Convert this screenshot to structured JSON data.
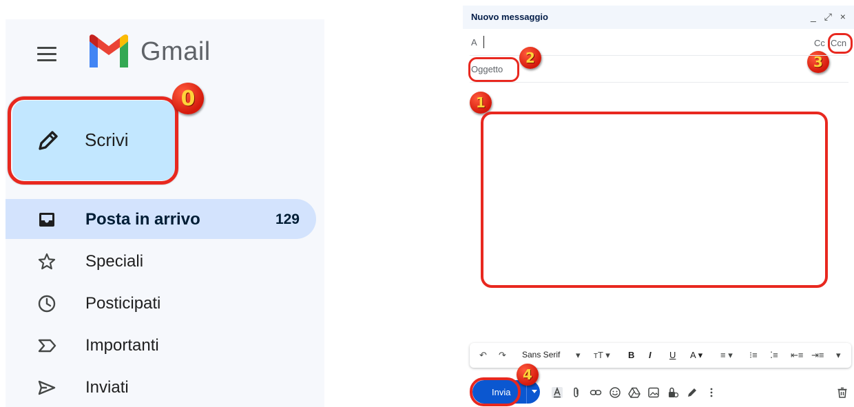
{
  "sidebar": {
    "brand": "Gmail",
    "compose_label": "Scrivi",
    "items": [
      {
        "label": "Posta in arrivo",
        "count": "129",
        "icon": "inbox-icon",
        "active": true
      },
      {
        "label": "Speciali",
        "icon": "star-icon"
      },
      {
        "label": "Posticipati",
        "icon": "clock-icon"
      },
      {
        "label": "Importanti",
        "icon": "important-icon"
      },
      {
        "label": "Inviati",
        "icon": "send-icon"
      }
    ]
  },
  "compose": {
    "title": "Nuovo messaggio",
    "window_controls": "_ ⤢ ×",
    "to_label": "A",
    "cc_label": "Cc",
    "bcc_label": "Ccn",
    "subject_placeholder": "Oggetto",
    "send_label": "Invia",
    "font_name": "Sans Serif",
    "format_buttons": [
      "↶",
      "↷",
      "Sans Serif",
      "▾",
      "ᴛT ▾",
      "B",
      "I",
      "U",
      "A ▾",
      "≡ ▾",
      "⁝≡",
      "⁚≡",
      "⇤≡",
      "⇥≡",
      "▾"
    ]
  },
  "annotations": {
    "step0": "0",
    "step1": "1",
    "step2": "2",
    "step3": "3",
    "step4": "4"
  },
  "colors": {
    "highlight": "#e8281f",
    "compose_button": "#c2e7ff",
    "active_item": "#d3e3fd",
    "send_button": "#0b57d0"
  }
}
